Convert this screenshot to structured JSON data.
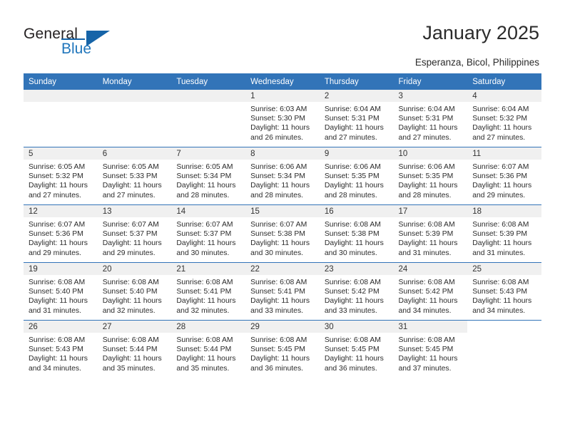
{
  "brand": {
    "name_line1": "General",
    "name_line2": "Blue",
    "accent_color": "#1664a8"
  },
  "header": {
    "title": "January 2025",
    "subtitle": "Esperanza, Bicol, Philippines"
  },
  "theme": {
    "header_row_color": "#3274b8",
    "daynum_band_color": "#f0f0f0"
  },
  "weekday_headers": [
    "Sunday",
    "Monday",
    "Tuesday",
    "Wednesday",
    "Thursday",
    "Friday",
    "Saturday"
  ],
  "weeks": [
    [
      {
        "day": "",
        "blank": true
      },
      {
        "day": "",
        "blank": true
      },
      {
        "day": "",
        "blank": true
      },
      {
        "day": "1",
        "sunrise": "Sunrise: 6:03 AM",
        "sunset": "Sunset: 5:30 PM",
        "daylight": "Daylight: 11 hours and 26 minutes."
      },
      {
        "day": "2",
        "sunrise": "Sunrise: 6:04 AM",
        "sunset": "Sunset: 5:31 PM",
        "daylight": "Daylight: 11 hours and 27 minutes."
      },
      {
        "day": "3",
        "sunrise": "Sunrise: 6:04 AM",
        "sunset": "Sunset: 5:31 PM",
        "daylight": "Daylight: 11 hours and 27 minutes."
      },
      {
        "day": "4",
        "sunrise": "Sunrise: 6:04 AM",
        "sunset": "Sunset: 5:32 PM",
        "daylight": "Daylight: 11 hours and 27 minutes."
      }
    ],
    [
      {
        "day": "5",
        "sunrise": "Sunrise: 6:05 AM",
        "sunset": "Sunset: 5:32 PM",
        "daylight": "Daylight: 11 hours and 27 minutes."
      },
      {
        "day": "6",
        "sunrise": "Sunrise: 6:05 AM",
        "sunset": "Sunset: 5:33 PM",
        "daylight": "Daylight: 11 hours and 27 minutes."
      },
      {
        "day": "7",
        "sunrise": "Sunrise: 6:05 AM",
        "sunset": "Sunset: 5:34 PM",
        "daylight": "Daylight: 11 hours and 28 minutes."
      },
      {
        "day": "8",
        "sunrise": "Sunrise: 6:06 AM",
        "sunset": "Sunset: 5:34 PM",
        "daylight": "Daylight: 11 hours and 28 minutes."
      },
      {
        "day": "9",
        "sunrise": "Sunrise: 6:06 AM",
        "sunset": "Sunset: 5:35 PM",
        "daylight": "Daylight: 11 hours and 28 minutes."
      },
      {
        "day": "10",
        "sunrise": "Sunrise: 6:06 AM",
        "sunset": "Sunset: 5:35 PM",
        "daylight": "Daylight: 11 hours and 28 minutes."
      },
      {
        "day": "11",
        "sunrise": "Sunrise: 6:07 AM",
        "sunset": "Sunset: 5:36 PM",
        "daylight": "Daylight: 11 hours and 29 minutes."
      }
    ],
    [
      {
        "day": "12",
        "sunrise": "Sunrise: 6:07 AM",
        "sunset": "Sunset: 5:36 PM",
        "daylight": "Daylight: 11 hours and 29 minutes."
      },
      {
        "day": "13",
        "sunrise": "Sunrise: 6:07 AM",
        "sunset": "Sunset: 5:37 PM",
        "daylight": "Daylight: 11 hours and 29 minutes."
      },
      {
        "day": "14",
        "sunrise": "Sunrise: 6:07 AM",
        "sunset": "Sunset: 5:37 PM",
        "daylight": "Daylight: 11 hours and 30 minutes."
      },
      {
        "day": "15",
        "sunrise": "Sunrise: 6:07 AM",
        "sunset": "Sunset: 5:38 PM",
        "daylight": "Daylight: 11 hours and 30 minutes."
      },
      {
        "day": "16",
        "sunrise": "Sunrise: 6:08 AM",
        "sunset": "Sunset: 5:38 PM",
        "daylight": "Daylight: 11 hours and 30 minutes."
      },
      {
        "day": "17",
        "sunrise": "Sunrise: 6:08 AM",
        "sunset": "Sunset: 5:39 PM",
        "daylight": "Daylight: 11 hours and 31 minutes."
      },
      {
        "day": "18",
        "sunrise": "Sunrise: 6:08 AM",
        "sunset": "Sunset: 5:39 PM",
        "daylight": "Daylight: 11 hours and 31 minutes."
      }
    ],
    [
      {
        "day": "19",
        "sunrise": "Sunrise: 6:08 AM",
        "sunset": "Sunset: 5:40 PM",
        "daylight": "Daylight: 11 hours and 31 minutes."
      },
      {
        "day": "20",
        "sunrise": "Sunrise: 6:08 AM",
        "sunset": "Sunset: 5:40 PM",
        "daylight": "Daylight: 11 hours and 32 minutes."
      },
      {
        "day": "21",
        "sunrise": "Sunrise: 6:08 AM",
        "sunset": "Sunset: 5:41 PM",
        "daylight": "Daylight: 11 hours and 32 minutes."
      },
      {
        "day": "22",
        "sunrise": "Sunrise: 6:08 AM",
        "sunset": "Sunset: 5:41 PM",
        "daylight": "Daylight: 11 hours and 33 minutes."
      },
      {
        "day": "23",
        "sunrise": "Sunrise: 6:08 AM",
        "sunset": "Sunset: 5:42 PM",
        "daylight": "Daylight: 11 hours and 33 minutes."
      },
      {
        "day": "24",
        "sunrise": "Sunrise: 6:08 AM",
        "sunset": "Sunset: 5:42 PM",
        "daylight": "Daylight: 11 hours and 34 minutes."
      },
      {
        "day": "25",
        "sunrise": "Sunrise: 6:08 AM",
        "sunset": "Sunset: 5:43 PM",
        "daylight": "Daylight: 11 hours and 34 minutes."
      }
    ],
    [
      {
        "day": "26",
        "sunrise": "Sunrise: 6:08 AM",
        "sunset": "Sunset: 5:43 PM",
        "daylight": "Daylight: 11 hours and 34 minutes."
      },
      {
        "day": "27",
        "sunrise": "Sunrise: 6:08 AM",
        "sunset": "Sunset: 5:44 PM",
        "daylight": "Daylight: 11 hours and 35 minutes."
      },
      {
        "day": "28",
        "sunrise": "Sunrise: 6:08 AM",
        "sunset": "Sunset: 5:44 PM",
        "daylight": "Daylight: 11 hours and 35 minutes."
      },
      {
        "day": "29",
        "sunrise": "Sunrise: 6:08 AM",
        "sunset": "Sunset: 5:45 PM",
        "daylight": "Daylight: 11 hours and 36 minutes."
      },
      {
        "day": "30",
        "sunrise": "Sunrise: 6:08 AM",
        "sunset": "Sunset: 5:45 PM",
        "daylight": "Daylight: 11 hours and 36 minutes."
      },
      {
        "day": "31",
        "sunrise": "Sunrise: 6:08 AM",
        "sunset": "Sunset: 5:45 PM",
        "daylight": "Daylight: 11 hours and 37 minutes."
      },
      {
        "day": "",
        "blank": true,
        "trailing": true
      }
    ]
  ]
}
